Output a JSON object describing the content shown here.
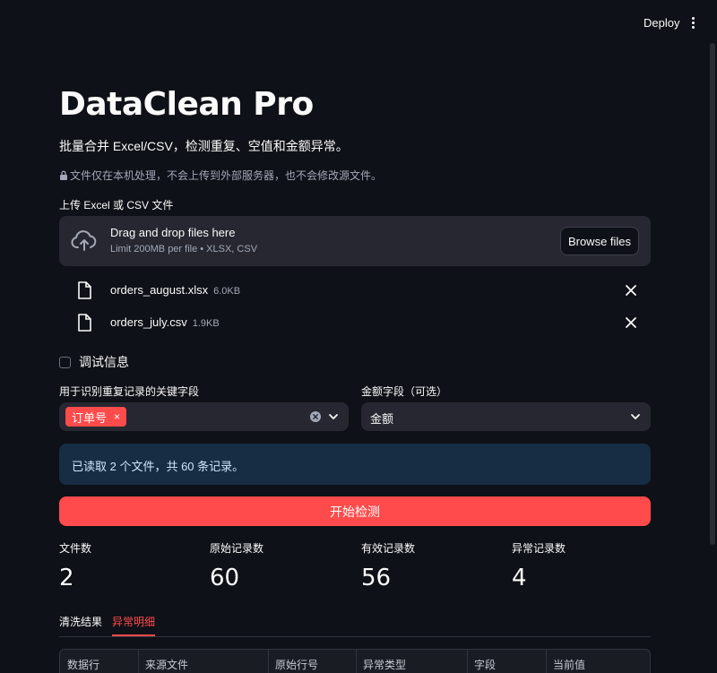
{
  "header": {
    "deploy_label": "Deploy",
    "menu_icon": "vertical-dots-icon"
  },
  "page": {
    "title": "DataClean Pro",
    "subtitle": "批量合并 Excel/CSV，检测重复、空值和金额异常。",
    "privacy_note": "文件仅在本机处理，不会上传到外部服务器，也不会修改源文件。"
  },
  "uploader": {
    "label": "上传 Excel 或 CSV 文件",
    "drop_title": "Drag and drop files here",
    "limit_text": "Limit 200MB per file • XLSX, CSV",
    "browse_label": "Browse files",
    "files": [
      {
        "name": "orders_august.xlsx",
        "size": "6.0KB"
      },
      {
        "name": "orders_july.csv",
        "size": "1.9KB"
      }
    ]
  },
  "debug": {
    "label": "调试信息",
    "checked": false
  },
  "key_fields": {
    "label": "用于识别重复记录的关键字段",
    "selected_tag": "订单号",
    "tag_remove": "×"
  },
  "amount_field": {
    "label": "金额字段（可选）",
    "value": "金额"
  },
  "info": {
    "message": "已读取 2 个文件，共 60 条记录。"
  },
  "actions": {
    "start_label": "开始检测"
  },
  "metrics": [
    {
      "label": "文件数",
      "value": "2"
    },
    {
      "label": "原始记录数",
      "value": "60"
    },
    {
      "label": "有效记录数",
      "value": "56"
    },
    {
      "label": "异常记录数",
      "value": "4"
    }
  ],
  "tabs": [
    {
      "label": "清洗结果",
      "active": false
    },
    {
      "label": "异常明细",
      "active": true
    }
  ],
  "table": {
    "columns": [
      "数据行",
      "来源文件",
      "原始行号",
      "异常类型",
      "字段",
      "当前值"
    ]
  },
  "colors": {
    "accent": "#ff4b4b",
    "background": "#0e1117",
    "surface": "#262730",
    "info": "#172d43"
  }
}
